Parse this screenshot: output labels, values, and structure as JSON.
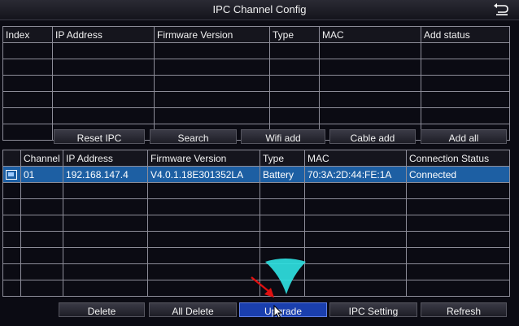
{
  "window": {
    "title": "IPC Channel Config",
    "back_icon": "return-arrow-icon"
  },
  "top_table": {
    "columns": [
      "Index",
      "IP Address",
      "Firmware Version",
      "Type",
      "MAC",
      "Add status"
    ],
    "rows": []
  },
  "top_buttons": {
    "reset_ipc": "Reset IPC",
    "search": "Search",
    "wifi_add": "Wifi add",
    "cable_add": "Cable add",
    "add_all": "Add all"
  },
  "bottom_table": {
    "columns": [
      "Channel",
      "IP Address",
      "Firmware Version",
      "Type",
      "MAC",
      "Connection Status"
    ],
    "rows": [
      {
        "channel": "01",
        "ip": "192.168.147.4",
        "firmware": "V4.0.1.18E301352LA",
        "type": "Battery",
        "mac": "70:3A:2D:44:FE:1A",
        "status": "Connected"
      }
    ]
  },
  "bottom_buttons": {
    "delete": "Delete",
    "all_delete": "All Delete",
    "upgrade": "Upgrade",
    "ipc_setting": "IPC Setting",
    "refresh": "Refresh"
  },
  "colors": {
    "background": "#0b0b13",
    "selected_row": "#1d5fa3",
    "active_button": "#1a3fae",
    "annotation_arrow": "#e01010",
    "cursor_highlight": "#2fe0e0"
  }
}
